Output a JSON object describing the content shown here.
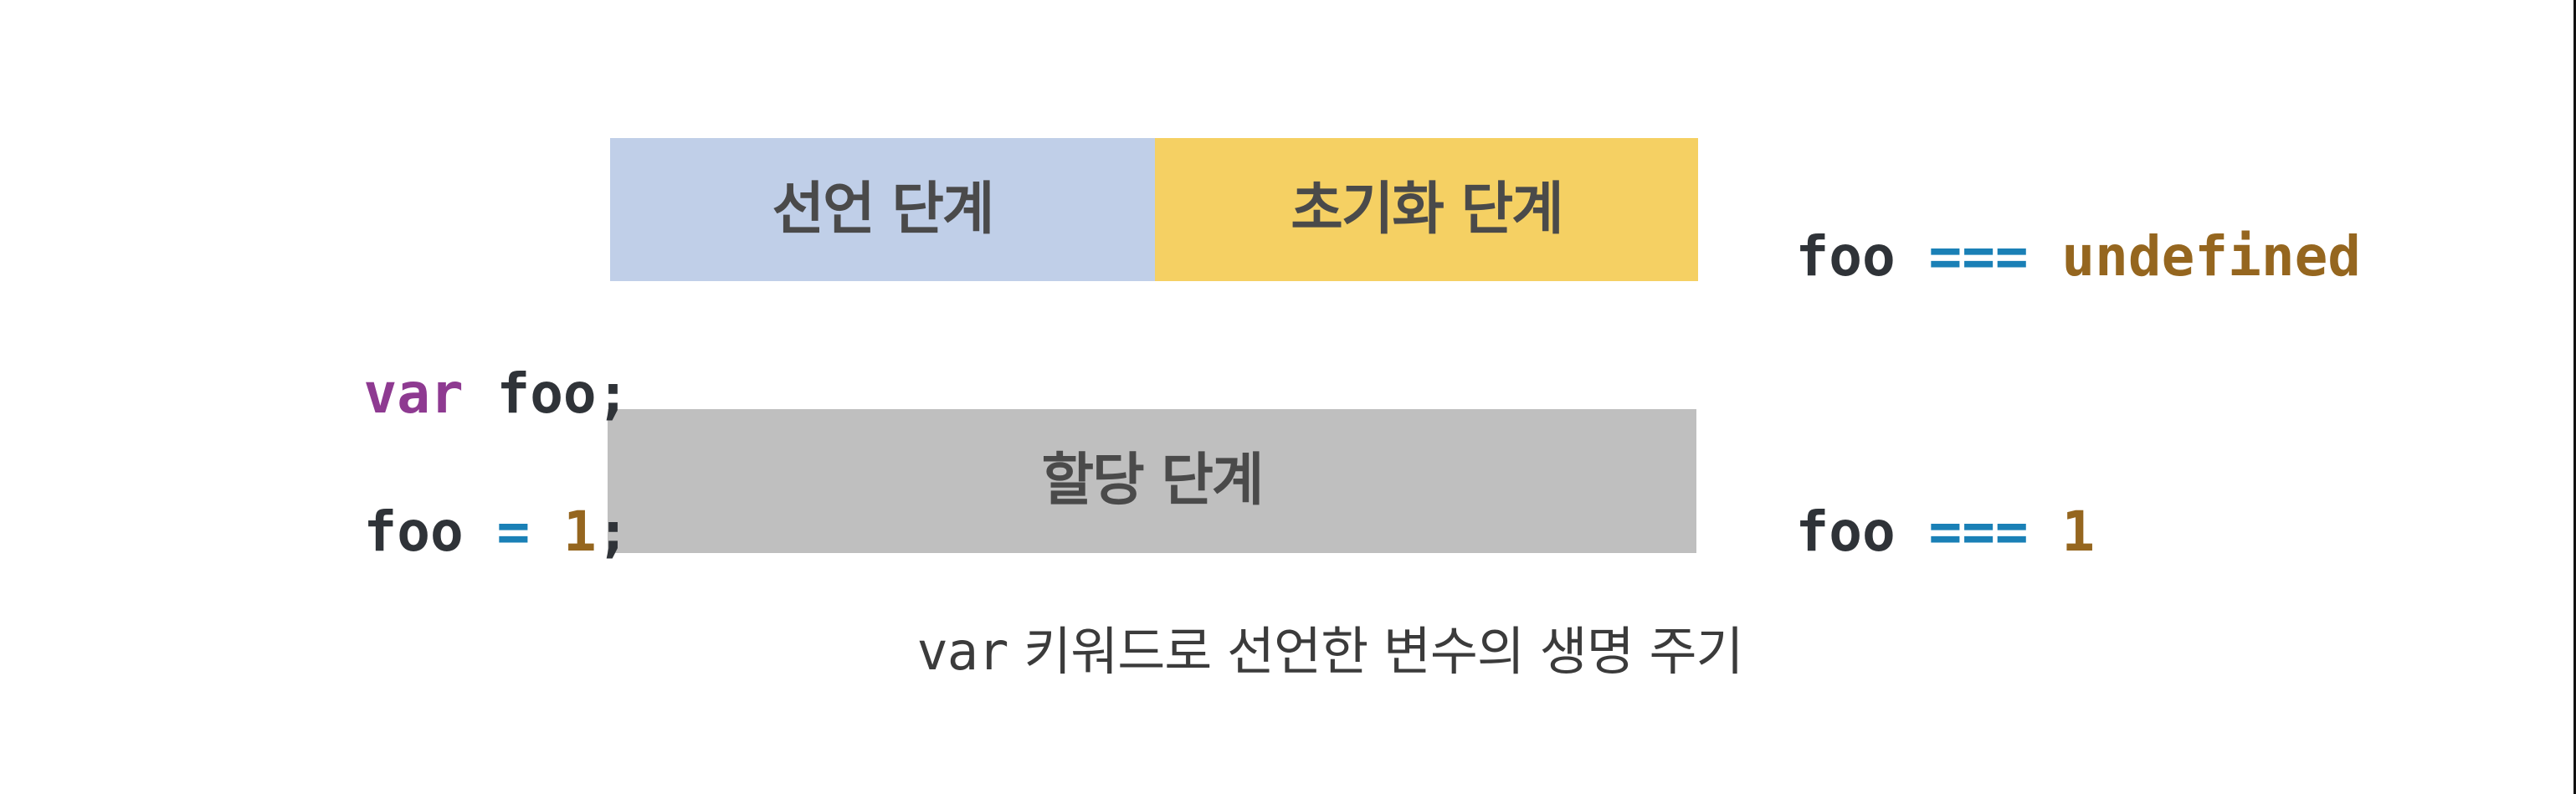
{
  "colors": {
    "declaration_box": "#c0cfe8",
    "initialization_box": "#f5d063",
    "assignment_box": "#bfbfbf",
    "phase_label_text": "#4a4a4a",
    "code_keyword": "#8e3a91",
    "code_identifier": "#2f3338",
    "code_operator": "#1a80b6",
    "code_literal": "#95661f",
    "caption_text": "#3b3b3b",
    "frame_border": "#111111"
  },
  "phases": {
    "declaration": {
      "label": "선언 단계"
    },
    "initialization": {
      "label": "초기화 단계"
    },
    "assignment": {
      "label": "할당 단계"
    }
  },
  "code": {
    "var_declaration": {
      "keyword": "var",
      "space": " ",
      "identifier": "foo",
      "terminator": ";"
    },
    "assignment": {
      "identifier": "foo",
      "space1": " ",
      "operator": "=",
      "space2": " ",
      "value": "1",
      "terminator": ";"
    },
    "check_undefined": {
      "identifier": "foo",
      "space1": " ",
      "operator": "===",
      "space2": " ",
      "value": "undefined"
    },
    "check_one": {
      "identifier": "foo",
      "space1": " ",
      "operator": "===",
      "space2": " ",
      "value": "1"
    }
  },
  "caption": {
    "code_part": "var",
    "text_part": " 키워드로 선언한 변수의 생명 주기"
  }
}
